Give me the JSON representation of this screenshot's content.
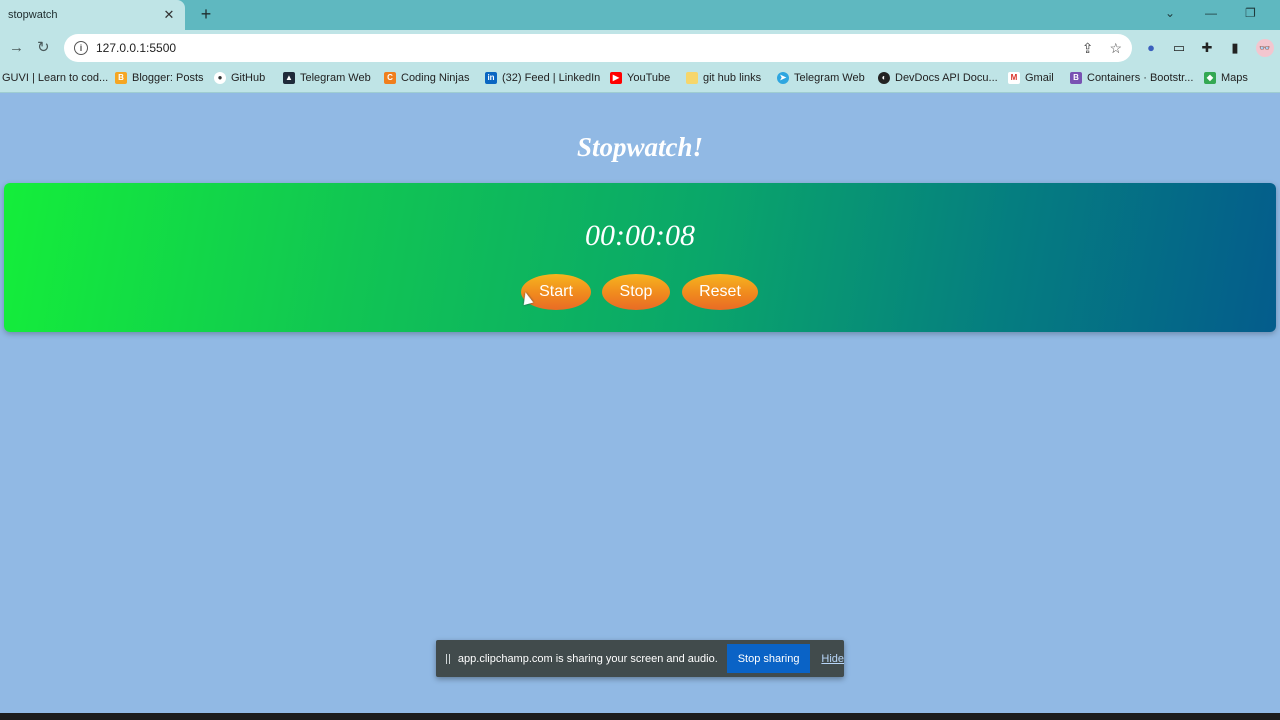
{
  "browser": {
    "tab_title": "stopwatch",
    "tab_close": "✕",
    "new_tab": "+",
    "url": "127.0.0.1:5500",
    "bookmarks": [
      {
        "label": "GUVI | Learn to cod...",
        "icon": "guvi-icon"
      },
      {
        "label": "Blogger: Posts",
        "icon": "blogger-icon",
        "color": "#f5a623"
      },
      {
        "label": "GitHub",
        "icon": "github-icon",
        "color": "#333333"
      },
      {
        "label": "Telegram Web",
        "icon": "telegram-icon",
        "color": "#1f2a3a"
      },
      {
        "label": "Coding Ninjas",
        "icon": "coding-ninjas-icon",
        "color": "#f07f1d"
      },
      {
        "label": "(32) Feed | LinkedIn",
        "icon": "linkedin-icon",
        "color": "#0a66c2"
      },
      {
        "label": "YouTube",
        "icon": "youtube-icon",
        "color": "#ff0000"
      },
      {
        "label": "git hub links",
        "icon": "folder-icon",
        "color": "#f6d66b"
      },
      {
        "label": "Telegram Web",
        "icon": "telegram-icon",
        "color": "#2ea6e0"
      },
      {
        "label": "DevDocs API Docu...",
        "icon": "devdocs-icon",
        "color": "#222222"
      },
      {
        "label": "Gmail",
        "icon": "gmail-icon",
        "color": "#d93025"
      },
      {
        "label": "Containers · Bootstr...",
        "icon": "bootstrap-icon",
        "color": "#7952b3"
      },
      {
        "label": "Maps",
        "icon": "maps-icon",
        "color": "#34a853"
      }
    ]
  },
  "page": {
    "title": "Stopwatch!",
    "timer": "00:00:08",
    "buttons": {
      "start": "Start",
      "stop": "Stop",
      "reset": "Reset"
    }
  },
  "share_bar": {
    "message": "app.clipchamp.com is sharing your screen and audio.",
    "stop_label": "Stop sharing",
    "hide_label": "Hide"
  },
  "colors": {
    "page_bg": "#91b9e4",
    "button": "#f0891e",
    "panel_start": "#14ee3a",
    "panel_end": "#045c8c",
    "stop_sharing": "#0a63c6"
  }
}
